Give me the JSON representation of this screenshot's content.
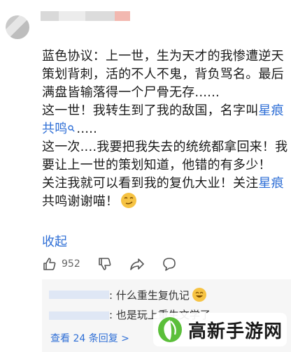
{
  "comment": {
    "p1": "蓝色协议：上一世，生为天才的我惨遭逆天策划背刺，活的不人不鬼，背负骂名。最后满盘皆输落得一个尸骨无存......",
    "p2_a": "这一世！我转生到了我的敌国，名字叫",
    "p2_blue": "星痕共鸣",
    "p2_tail": ".....",
    "p3": "这一次....我要把我失去的统统都拿回来！我要让上一世的策划知道，他错的有多少！",
    "p4_a": "关注我就可以看到我的复仇大业！关注",
    "p4_blue": "星痕",
    "p4_b": "共鸣谢谢喵！",
    "collapse": "收起"
  },
  "actions": {
    "like_count": "952"
  },
  "replies": {
    "r1": ": 什么重生复仇记",
    "r2": ": 也是玩上重生文学了",
    "see_more": "查看 24 条回复 >"
  },
  "watermark": {
    "text": "高新手游网"
  }
}
